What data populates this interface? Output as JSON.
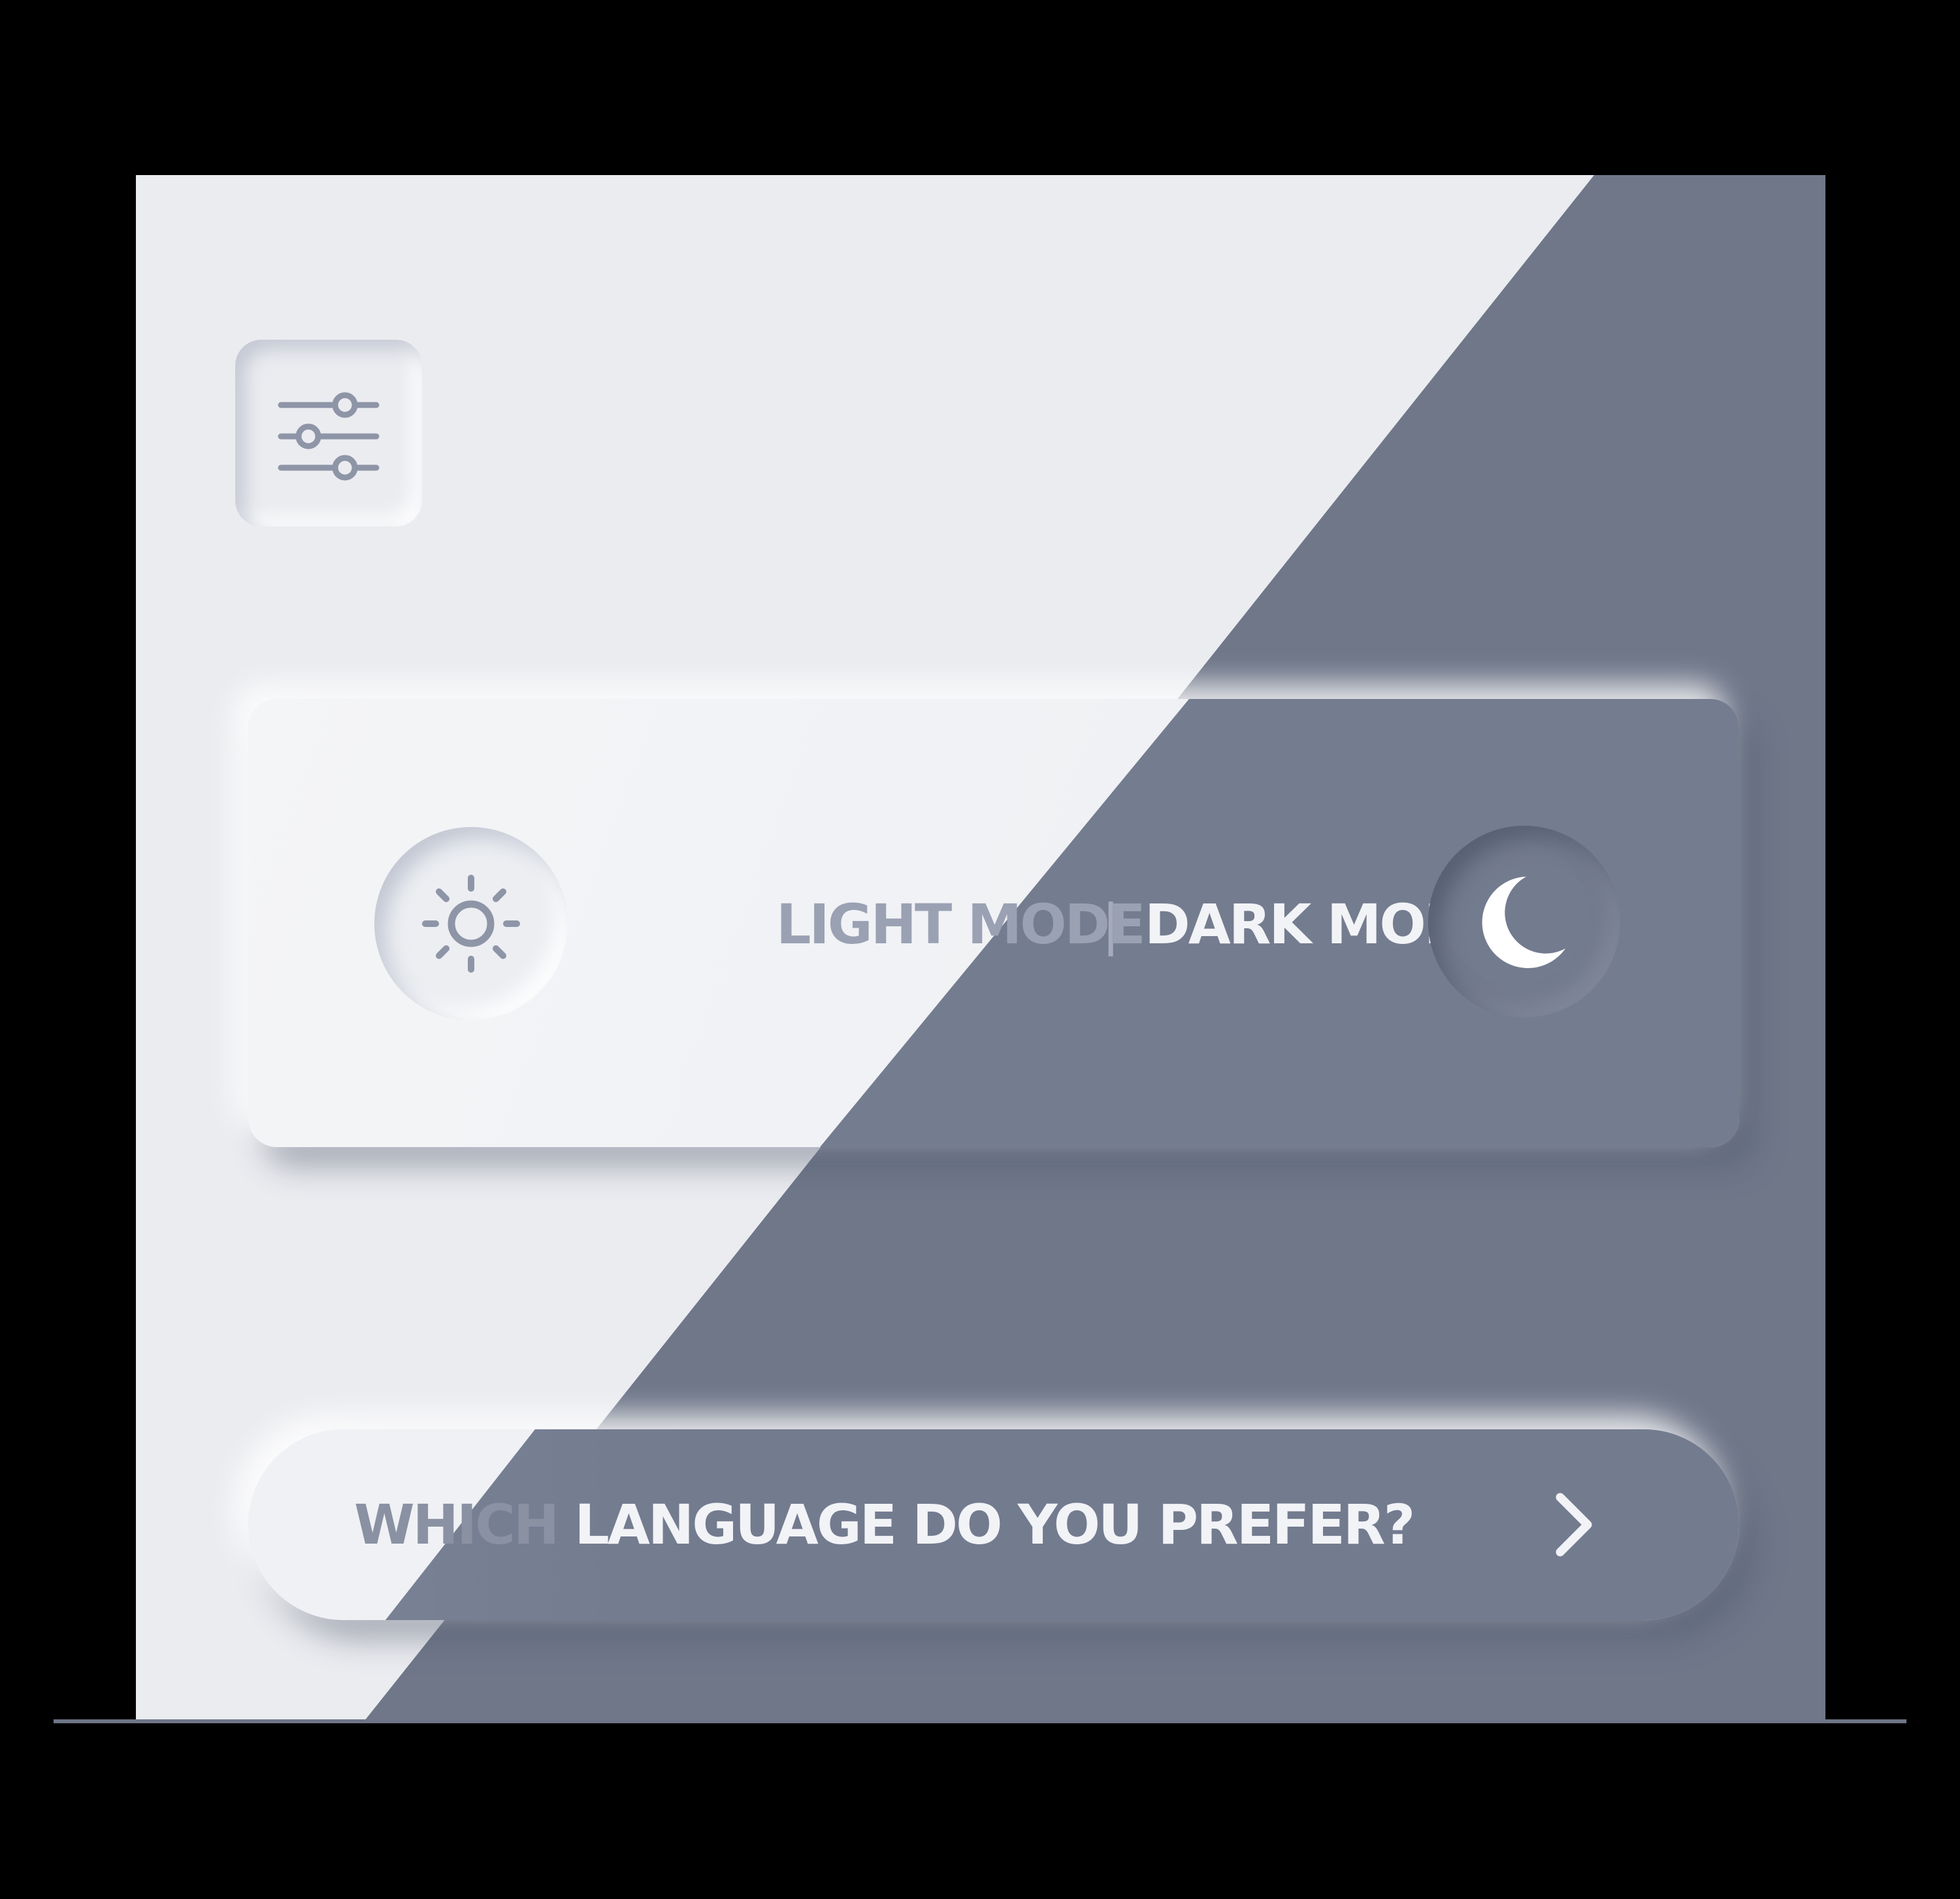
{
  "settings": {
    "icon": "sliders-icon"
  },
  "mode_toggle": {
    "light_label": "LIGHT MODE",
    "separator": "|",
    "dark_label": "DARK MODE",
    "light_icon": "sun-icon",
    "dark_icon": "moon-icon"
  },
  "language": {
    "prompt_light_part": "WHICH",
    "prompt_rest": " LANGUAGE DO YOU PREFER?",
    "icon": "chevron-right-icon"
  },
  "colors": {
    "light_bg": "#ebecf0",
    "dark_bg": "#6f7789",
    "light_text": "#9aa1b3",
    "dark_text": "#f2f3f6",
    "page_bg": "#000000"
  }
}
